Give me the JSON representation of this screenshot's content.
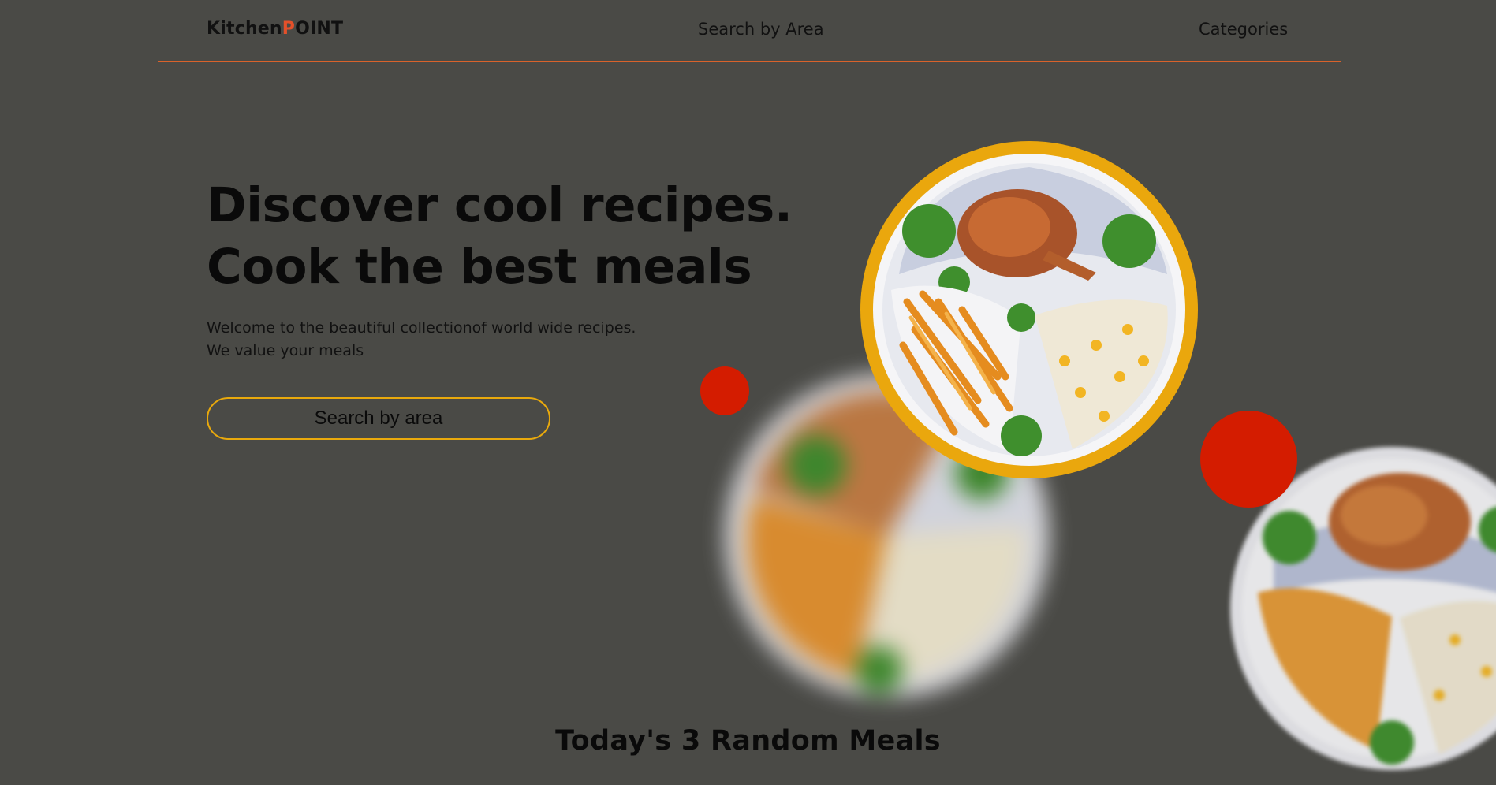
{
  "brand": {
    "logo_prefix": "Kitchen",
    "logo_accent": "P",
    "logo_suffix": "OINT",
    "accent_color": "#e4502a"
  },
  "nav": {
    "search_by_area": "Search by Area",
    "categories": "Categories"
  },
  "hero": {
    "title": "Discover cool recipes. Cook the best meals",
    "subtitle_line1": "Welcome to the beautiful collectionof world wide recipes.",
    "subtitle_line2": "We value your meals",
    "cta_label": "Search by area",
    "cta_border_color": "#e9a90c"
  },
  "section": {
    "random_meals_title": "Today's 3 Random Meals"
  },
  "images": {
    "hero_plate": "roast-chicken-fries-rice-plate",
    "decor_dot_color": "#d41c00",
    "plate_ring_color": "#eaa70d"
  }
}
